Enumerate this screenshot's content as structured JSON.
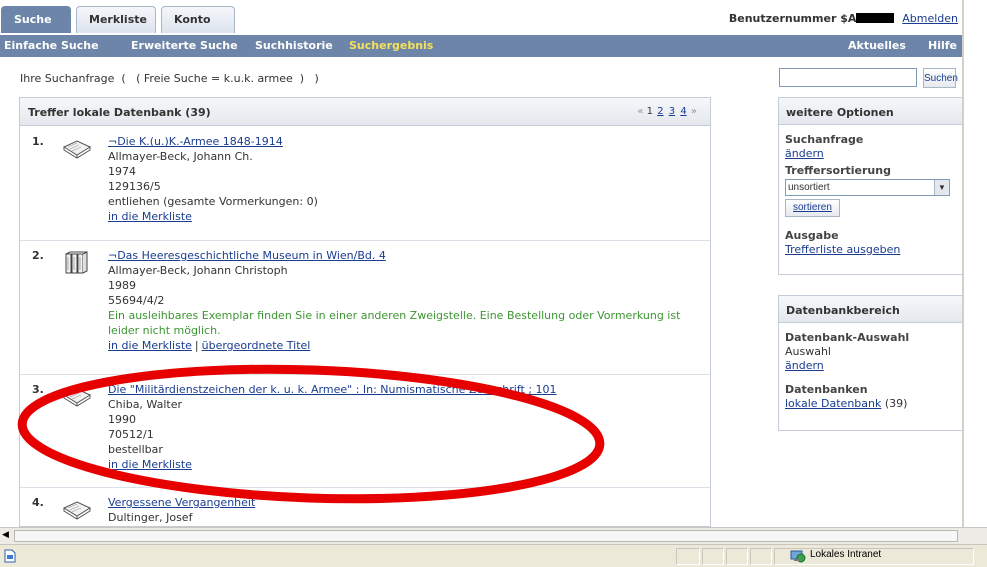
{
  "tabs": [
    "Suche",
    "Merkliste",
    "Konto"
  ],
  "user": {
    "label": "Benutzernummer $A",
    "logout": "Abmelden"
  },
  "nav": {
    "items": [
      "Einfache Suche",
      "Erweiterte Suche",
      "Suchhistorie",
      "Suchergebnis"
    ],
    "right": [
      "Aktuelles",
      "Hilfe"
    ]
  },
  "query": {
    "text": "Ihre Suchanfrage  (   ( Freie Suche = k.u.k. armee  )   )"
  },
  "search": {
    "placeholder": "",
    "button": "Suchen"
  },
  "results": {
    "title": "Treffer lokale Datenbank (39)",
    "pager": {
      "prev": "«",
      "pages": [
        "1",
        "2",
        "3",
        "4"
      ],
      "next": "»"
    },
    "hits": [
      {
        "num": "1.",
        "icon": "book-icon",
        "title": "¬Die K.(u.)K.-Armee 1848-1914",
        "author": "Allmayer-Beck, Johann Ch.",
        "year": "1974",
        "signature": "129136/5",
        "status": "entliehen (gesamte Vormerkungen: 0)",
        "links": [
          "in die Merkliste"
        ]
      },
      {
        "num": "2.",
        "icon": "books-series-icon",
        "title": "¬Das Heeresgeschichtliche Museum in Wien/Bd. 4",
        "author": "Allmayer-Beck, Johann Christoph",
        "year": "1989",
        "signature": "55694/4/2",
        "status": "Ein ausleihbares Exemplar finden Sie in einer anderen Zweigstelle. Eine Bestellung oder Vormerkung ist leider nicht möglich.",
        "links": [
          "in die Merkliste",
          "übergeordnete Titel"
        ]
      },
      {
        "num": "3.",
        "icon": "book-icon",
        "title": "Die \"Militärdienstzeichen der k. u. k. Armee\" : In: Numismatische Zeitschrift ; 101",
        "author": "Chiba, Walter",
        "year": "1990",
        "signature": "70512/1",
        "status": "bestellbar",
        "links": [
          "in die Merkliste"
        ]
      },
      {
        "num": "4.",
        "icon": "book-icon",
        "title": "Vergessene Vergangenheit",
        "author": "Dultinger, Josef"
      }
    ]
  },
  "options": {
    "title": "weitere Optionen",
    "query_label": "Suchanfrage",
    "query_link": "ändern",
    "sort_label": "Treffersortierung",
    "sort_value": "unsortiert",
    "sort_button": "sortieren",
    "output_label": "Ausgabe",
    "output_link": "Trefferliste ausgeben"
  },
  "database": {
    "title": "Datenbankbereich",
    "select_label": "Datenbank-Auswahl",
    "select_value": "Auswahl",
    "select_link": "ändern",
    "db_label": "Datenbanken",
    "db_link": "lokale Datenbank",
    "db_count": "(39)"
  },
  "statusbar": {
    "zone": "Lokales Intranet"
  },
  "colors": {
    "nav": "#6c85a8",
    "current_nav": "#f5e15a",
    "link": "#1a3d8f",
    "green_status": "#3c9632",
    "annotation": "#e60000"
  }
}
